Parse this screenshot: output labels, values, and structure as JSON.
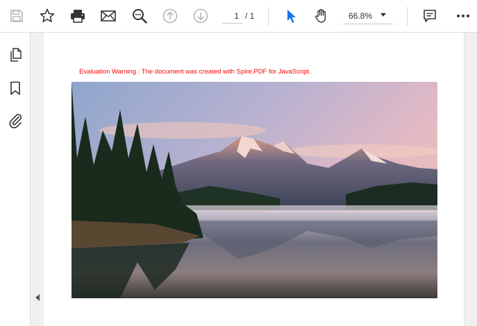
{
  "toolbar": {
    "tools": [
      {
        "name": "save-icon"
      },
      {
        "name": "bookmark-star-icon"
      },
      {
        "name": "print-icon"
      },
      {
        "name": "email-icon"
      },
      {
        "name": "search-zoom-icon"
      },
      {
        "name": "previous-page-icon"
      },
      {
        "name": "next-page-icon"
      }
    ],
    "page_current": "1",
    "page_total": "/ 1",
    "zoom": "66.8%",
    "right_tools": [
      {
        "name": "select-cursor-icon"
      },
      {
        "name": "hand-pan-icon"
      },
      {
        "name": "comment-icon"
      },
      {
        "name": "more-options-icon"
      }
    ],
    "accent_color": "#1a73e8"
  },
  "sidebar": {
    "items": [
      {
        "name": "page-thumbnails-icon"
      },
      {
        "name": "bookmark-icon"
      },
      {
        "name": "attachment-icon"
      }
    ]
  },
  "document": {
    "warning_text": "Evaluation Warning : The document was created with Spire.PDF for JavaScript.",
    "warning_color": "#ff0000",
    "image": "mountain-lake-sunrise"
  }
}
